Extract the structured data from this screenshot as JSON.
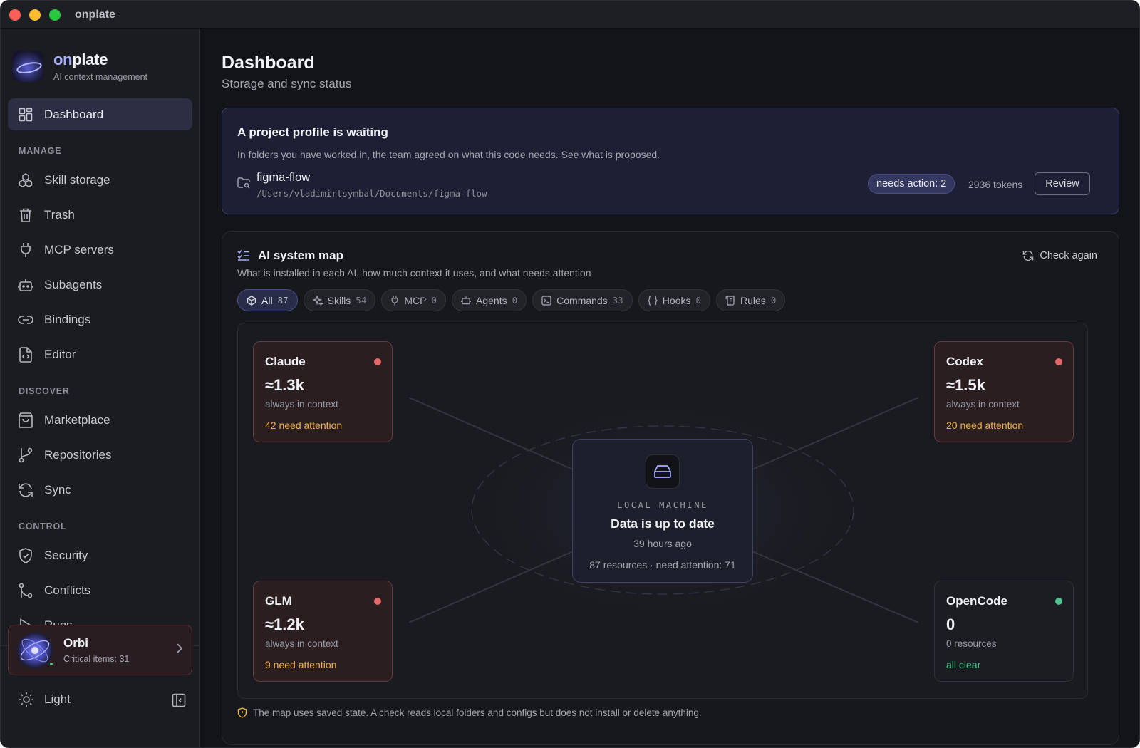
{
  "window": {
    "title": "onplate"
  },
  "brand": {
    "name_prefix": "on",
    "name_suffix": "plate",
    "subtitle": "AI context management"
  },
  "nav": {
    "dashboard": "Dashboard",
    "section_manage": "MANAGE",
    "skill_storage": "Skill storage",
    "trash": "Trash",
    "mcp_servers": "MCP servers",
    "subagents": "Subagents",
    "bindings": "Bindings",
    "editor": "Editor",
    "section_discover": "DISCOVER",
    "marketplace": "Marketplace",
    "repositories": "Repositories",
    "sync": "Sync",
    "section_control": "CONTROL",
    "security": "Security",
    "conflicts": "Conflicts",
    "runs": "Runs"
  },
  "orbi": {
    "name": "Orbi",
    "subtitle": "Critical items: 31"
  },
  "theme": {
    "label": "Light"
  },
  "page": {
    "title": "Dashboard",
    "subtitle": "Storage and sync status"
  },
  "profile": {
    "title": "A project profile is waiting",
    "description": "In folders you have worked in, the team agreed on what this code needs. See what is proposed.",
    "project_name": "figma-flow",
    "project_path": "/Users/vladimirtsymbal/Documents/figma-flow",
    "badge": "needs action: 2",
    "tokens": "2936 tokens",
    "review_label": "Review"
  },
  "map": {
    "title": "AI system map",
    "description": "What is installed in each AI, how much context it uses, and what needs attention",
    "check_label": "Check again",
    "filters": [
      {
        "label": "All",
        "count": "87"
      },
      {
        "label": "Skills",
        "count": "54"
      },
      {
        "label": "MCP",
        "count": "0"
      },
      {
        "label": "Agents",
        "count": "0"
      },
      {
        "label": "Commands",
        "count": "33"
      },
      {
        "label": "Hooks",
        "count": "0"
      },
      {
        "label": "Rules",
        "count": "0"
      }
    ],
    "nodes": {
      "claude": {
        "name": "Claude",
        "value": "≈1.3k",
        "sub": "always in context",
        "status": "42 need attention"
      },
      "codex": {
        "name": "Codex",
        "value": "≈1.5k",
        "sub": "always in context",
        "status": "20 need attention"
      },
      "glm": {
        "name": "GLM",
        "value": "≈1.2k",
        "sub": "always in context",
        "status": "9 need attention"
      },
      "opencode": {
        "name": "OpenCode",
        "value": "0",
        "sub": "0 resources",
        "status": "all clear"
      }
    },
    "center": {
      "label": "LOCAL MACHINE",
      "title": "Data is up to date",
      "time": "39 hours ago",
      "meta": "87 resources · need attention: 71"
    },
    "footnote": "The map uses saved state. A check reads local folders and configs but does not install or delete anything."
  },
  "colors": {
    "accent": "#a9aefc",
    "warn_dot": "#e46a6a",
    "ok_dot": "#4ec48a",
    "attention_text": "#f0b24a",
    "clear_text": "#4ec48a"
  }
}
